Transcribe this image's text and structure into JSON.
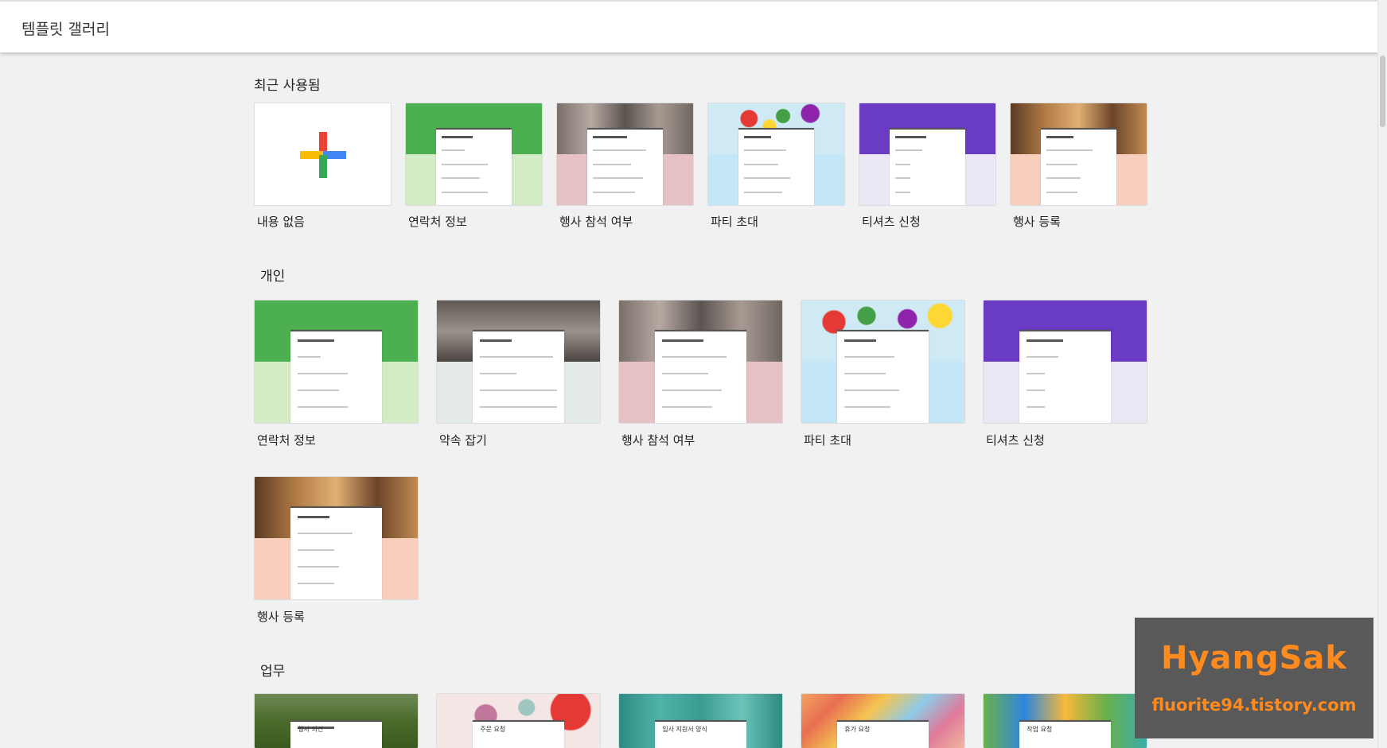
{
  "header": {
    "title": "템플릿 갤러리"
  },
  "sections": {
    "recent": {
      "title": "최근 사용됨",
      "items": [
        "내용 없음",
        "연락처 정보",
        "행사 참석 여부",
        "파티 초대",
        "티셔츠 신청",
        "행사 등록"
      ]
    },
    "personal": {
      "title": "개인",
      "items": [
        "연락처 정보",
        "약속 잡기",
        "행사 참석 여부",
        "파티 초대",
        "티셔츠 신청",
        "행사 등록"
      ]
    },
    "work": {
      "title": "업무",
      "items": [
        "행사 의견",
        "주문 요청",
        "입사 지원서 양식",
        "휴가 요청",
        "작업 요청"
      ]
    }
  },
  "watermark": {
    "line1": "HyangSak",
    "line2": "fluorite94.tistory.com"
  },
  "colors": {
    "contact": "#4caf50",
    "contact_bg": "#d4ecc6",
    "rsvp_bg": "#e6c2c4",
    "party_bg": "#c4e7f7",
    "tshirt": "#6a3cc4",
    "tshirt_bg": "#ece7f5",
    "event_bg": "#f8cfbd"
  }
}
